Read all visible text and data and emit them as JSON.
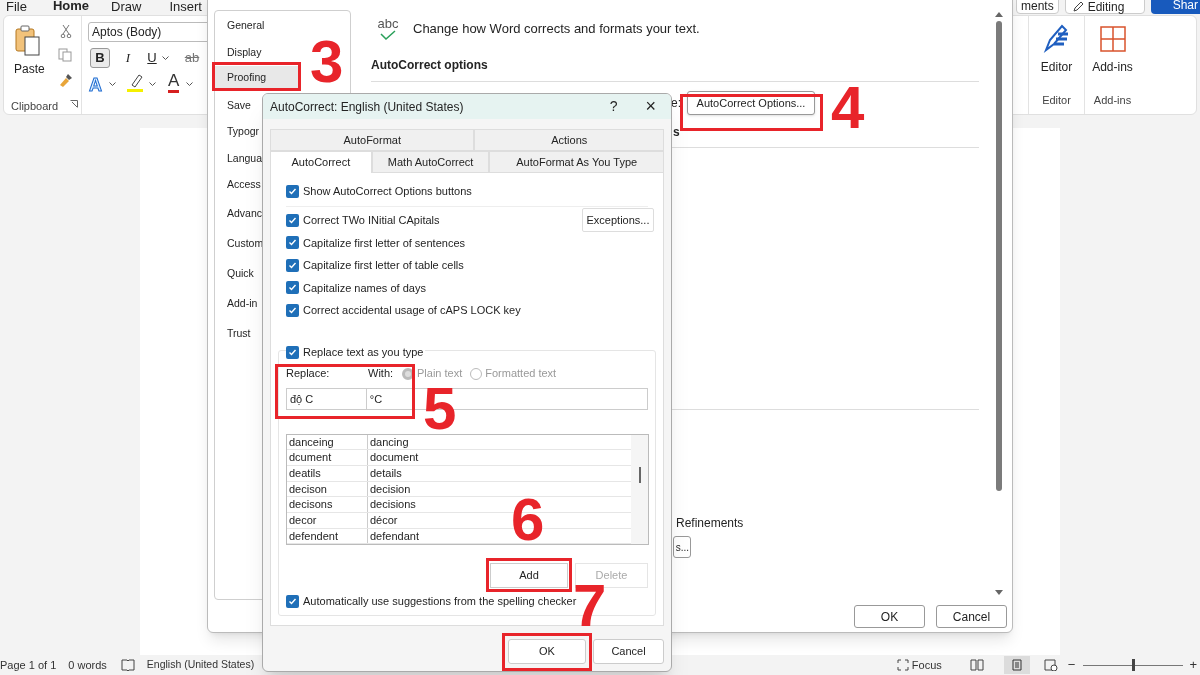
{
  "app_tabs": [
    {
      "label": "File",
      "selected": false
    },
    {
      "label": "Home",
      "selected": true
    },
    {
      "label": "Draw",
      "selected": false
    },
    {
      "label": "Insert",
      "selected": false
    }
  ],
  "ribbon": {
    "paste_label": "Paste",
    "clipboard_group": "Clipboard",
    "font_name": "Aptos (Body)",
    "format_buttons": [
      {
        "label": "B",
        "selected": true
      },
      {
        "label": "I",
        "selected": false
      },
      {
        "label": "U",
        "selected": false
      },
      {
        "label": "ab",
        "selected": false
      }
    ],
    "text_effects": "A",
    "font_color": "A",
    "top_buttons": [
      {
        "kind": "plain",
        "label": "ments"
      },
      {
        "kind": "dropdown",
        "label": "Editing"
      },
      {
        "kind": "primary",
        "label": "Shar"
      }
    ],
    "right_groups": [
      {
        "kind": "editor",
        "label": "Editor",
        "group_label": "Editor"
      },
      {
        "kind": "addins",
        "label": "Add-ins",
        "group_label": "Add-ins"
      }
    ]
  },
  "options_dialog": {
    "nav": [
      {
        "label": "General",
        "selected": false
      },
      {
        "label": "Display",
        "selected": false
      },
      {
        "label": "Proofing",
        "selected": true
      },
      {
        "label": "Save",
        "selected": false
      },
      {
        "label": "Typogr",
        "selected": false
      },
      {
        "label": "Langua",
        "selected": false
      },
      {
        "label": "Access",
        "selected": false
      },
      {
        "label": "Advanc",
        "selected": false
      },
      {
        "label": "Custom",
        "selected": false
      },
      {
        "label": "Quick",
        "selected": false
      },
      {
        "label": "Add-in",
        "selected": false
      },
      {
        "label": "Trust",
        "selected": false
      }
    ],
    "icon_text": "abc",
    "intro": "Change how Word corrects and formats your text.",
    "section_title": "AutoCorrect options",
    "partial_label": "e:",
    "autocorrect_button": "AutoCorrect Options...",
    "partial_heading": "s",
    "refinements": "Refinements",
    "partial_button": "s...",
    "ok": "OK",
    "cancel": "Cancel"
  },
  "autocorrect_dialog": {
    "title": "AutoCorrect: English (United States)",
    "help": "?",
    "close": "×",
    "tabs_top": [
      {
        "label": "AutoFormat",
        "selected": false
      },
      {
        "label": "Actions",
        "selected": false
      }
    ],
    "tabs_bottom": [
      {
        "label": "AutoCorrect",
        "selected": true
      },
      {
        "label": "Math AutoCorrect",
        "selected": false
      },
      {
        "label": "AutoFormat As You Type",
        "selected": false
      }
    ],
    "show_buttons": {
      "label": "Show AutoCorrect Options buttons",
      "checked": true
    },
    "options": [
      {
        "label": "Correct TWo INitial CApitals",
        "checked": true
      },
      {
        "label": "Capitalize first letter of sentences",
        "checked": true
      },
      {
        "label": "Capitalize first letter of table cells",
        "checked": true
      },
      {
        "label": "Capitalize names of days",
        "checked": true
      },
      {
        "label": "Correct accidental usage of cAPS LOCK key",
        "checked": true
      }
    ],
    "exceptions": "Exceptions...",
    "replace_as_you_type": {
      "label": "Replace text as you type",
      "checked": true
    },
    "replace_label": "Replace:",
    "with_label": "With:",
    "format_options": [
      {
        "label": "Plain text",
        "selected": true
      },
      {
        "label": "Formatted text",
        "selected": false
      }
    ],
    "replace_value": "độ C",
    "with_value": "°C",
    "entries": [
      {
        "from": "danceing",
        "to": "dancing"
      },
      {
        "from": "dcument",
        "to": "document"
      },
      {
        "from": "deatils",
        "to": "details"
      },
      {
        "from": "decison",
        "to": "decision"
      },
      {
        "from": "decisons",
        "to": "decisions"
      },
      {
        "from": "decor",
        "to": "décor"
      },
      {
        "from": "defendent",
        "to": "defendant"
      }
    ],
    "add": "Add",
    "delete": "Delete",
    "spelling_suggestions": {
      "label": "Automatically use suggestions from the spelling checker",
      "checked": true
    },
    "ok": "OK",
    "cancel": "Cancel"
  },
  "annotations": [
    {
      "number": "3"
    },
    {
      "number": "4"
    },
    {
      "number": "5"
    },
    {
      "number": "6"
    },
    {
      "number": "7"
    }
  ],
  "status_bar": {
    "page": "Page 1 of 1",
    "words": "0 words",
    "language": "English (United States)",
    "focus": "Focus",
    "minus": "−",
    "plus": "+",
    "zoom": {
      "level": 0.5
    }
  }
}
